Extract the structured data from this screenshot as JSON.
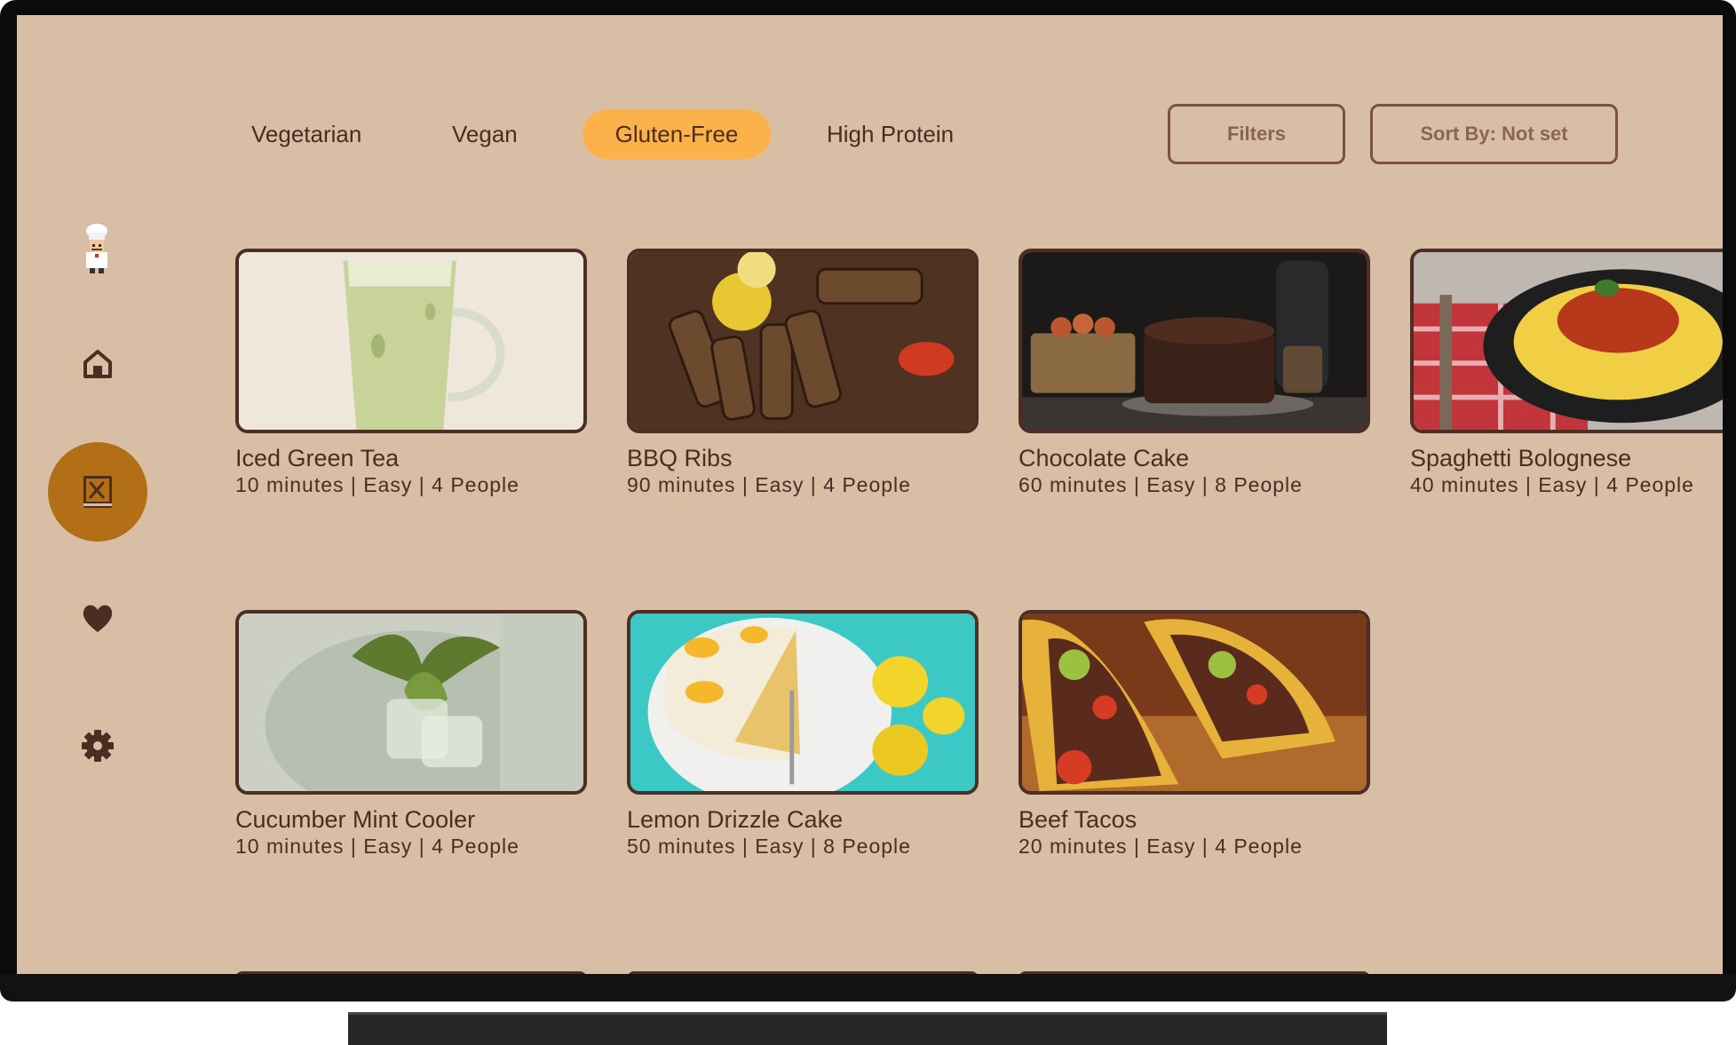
{
  "app": {
    "colors": {
      "background": "#d9bea6",
      "accent": "#fbb24b",
      "nav_active": "#b36f15",
      "text": "#4d2c22"
    }
  },
  "sidebar": {
    "avatar": "chef-avatar",
    "items": [
      {
        "name": "home",
        "icon": "home-icon"
      },
      {
        "name": "recipes",
        "icon": "recipe-book-icon",
        "active": true
      },
      {
        "name": "favorites",
        "icon": "heart-icon"
      },
      {
        "name": "settings",
        "icon": "gear-icon"
      }
    ]
  },
  "filters": {
    "chips": [
      {
        "label": "Vegetarian",
        "selected": false
      },
      {
        "label": "Vegan",
        "selected": false
      },
      {
        "label": "Gluten-Free",
        "selected": true
      },
      {
        "label": "High Protein",
        "selected": false
      }
    ],
    "filters_button": "Filters",
    "sort_button": "Sort By: Not set"
  },
  "recipes": [
    {
      "title": "Iced Green Tea",
      "meta": "10 minutes | Easy | 4 People"
    },
    {
      "title": "BBQ Ribs",
      "meta": "90 minutes | Easy | 4 People"
    },
    {
      "title": "Chocolate Cake",
      "meta": "60 minutes | Easy | 8 People"
    },
    {
      "title": "Spaghetti Bolognese",
      "meta": "40 minutes | Easy | 4 People"
    },
    {
      "title": "Cucumber Mint Cooler",
      "meta": "10 minutes | Easy | 4 People"
    },
    {
      "title": "Lemon Drizzle Cake",
      "meta": "50 minutes | Easy | 8 People"
    },
    {
      "title": "Beef Tacos",
      "meta": "20 minutes | Easy | 4 People"
    }
  ]
}
